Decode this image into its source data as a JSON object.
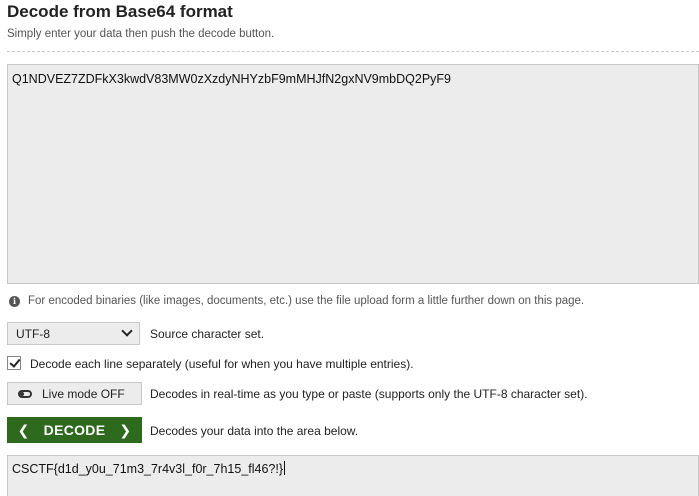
{
  "page": {
    "title": "Decode from Base64 format",
    "subtitle": "Simply enter your data then push the decode button."
  },
  "input": {
    "value": "Q1NDVEZ7ZDFkX3kwdV83MW0zXzdyNHYzbF9mMHJfN2gxNV9mbDQ2PyF9"
  },
  "info": {
    "text": "For encoded binaries (like images, documents, etc.) use the file upload form a little further down on this page."
  },
  "charset": {
    "selected": "UTF-8",
    "label": "Source character set."
  },
  "decode_each_line": {
    "checked": true,
    "label": "Decode each line separately (useful for when you have multiple entries)."
  },
  "live_mode": {
    "button_label": "Live mode OFF",
    "description": "Decodes in real-time as you type or paste (supports only the UTF-8 character set)."
  },
  "decode": {
    "button_label": "DECODE",
    "description": "Decodes your data into the area below."
  },
  "output": {
    "value": "CSCTF{d1d_y0u_71m3_7r4v3l_f0r_7h15_fl46?!}"
  },
  "colors": {
    "decode_button": "#2d6a1e",
    "field_background": "#ececec"
  }
}
